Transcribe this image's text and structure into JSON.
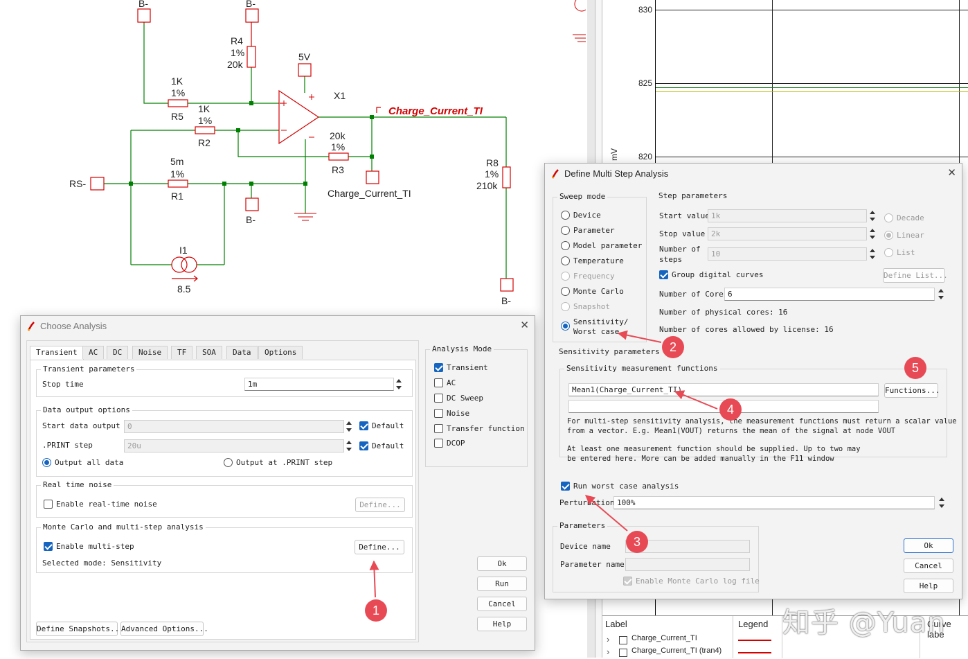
{
  "schematic": {
    "components": {
      "r4": {
        "name": "R4",
        "tol": "1%",
        "value": "20k"
      },
      "r5": {
        "name": "R5",
        "tol": "1%",
        "value": "1K"
      },
      "r2": {
        "name": "R2",
        "tol": "1%",
        "value": "1K"
      },
      "r1": {
        "name": "R1",
        "tol": "1%",
        "value": "5m"
      },
      "r3": {
        "name": "R3",
        "tol": "1%",
        "value": "20k"
      },
      "r8": {
        "name": "R8",
        "tol": "1%",
        "value": "210k"
      },
      "i1": {
        "name": "I1",
        "value": "8.5"
      },
      "x1": {
        "name": "X1"
      }
    },
    "nets": {
      "b_minus": "B-",
      "supply": "5V",
      "rs_minus": "RS-",
      "probe_label": "Charge_Current_TI",
      "node_label": "Charge_Current_TI"
    }
  },
  "graph": {
    "y_ticks": [
      "830",
      "825",
      "820"
    ],
    "y_unit_label": "mV",
    "legend_header_label": "Label",
    "legend_header_legend": "Legend",
    "legend_header_curve": "Curve labe",
    "traces": [
      {
        "label": "Charge_Current_TI",
        "color": "#d40000"
      },
      {
        "label": "Charge_Current_TI (tran4)",
        "color": "#d40000"
      }
    ]
  },
  "watermark": "知乎 @Yuan",
  "choose_analysis": {
    "title": "Choose Analysis",
    "tabs": [
      "Transient",
      "AC",
      "DC",
      "Noise",
      "TF",
      "SOA",
      "Data",
      "Options"
    ],
    "active_tab": "Transient",
    "transient_params": {
      "title": "Transient parameters",
      "stop_time_label": "Stop time",
      "stop_time_value": "1m"
    },
    "data_output": {
      "title": "Data output options",
      "start_label": "Start data output @",
      "start_value": "0",
      "start_default_label": "Default",
      "start_default_checked": true,
      "print_step_label": ".PRINT step",
      "print_step_value": "20u",
      "print_default_label": "Default",
      "print_default_checked": true,
      "output_all_label": "Output all data",
      "output_print_label": "Output at .PRINT step",
      "output_mode": "all"
    },
    "real_time_noise": {
      "title": "Real time noise",
      "enable_label": "Enable real-time noise",
      "enabled": false,
      "define_label": "Define..."
    },
    "monte_carlo": {
      "title": "Monte Carlo and multi-step analysis",
      "enable_label": "Enable multi-step",
      "enabled": true,
      "define_label": "Define...",
      "selected_mode": "Selected mode: Sensitivity"
    },
    "define_snapshots_label": "Define Snapshots...",
    "advanced_options_label": "Advanced Options...",
    "analysis_mode": {
      "title": "Analysis Mode",
      "items": [
        {
          "label": "Transient",
          "checked": true
        },
        {
          "label": "AC",
          "checked": false
        },
        {
          "label": "DC Sweep",
          "checked": false
        },
        {
          "label": "Noise",
          "checked": false
        },
        {
          "label": "Transfer function",
          "checked": false
        },
        {
          "label": "DCOP",
          "checked": false
        }
      ]
    },
    "buttons": {
      "ok": "Ok",
      "run": "Run",
      "cancel": "Cancel",
      "help": "Help"
    }
  },
  "multi_step": {
    "title": "Define Multi Step Analysis",
    "sweep_mode": {
      "title": "Sweep mode",
      "selected": "Sensitivity/ Worst case",
      "items": [
        {
          "label": "Device",
          "enabled": true
        },
        {
          "label": "Parameter",
          "enabled": true
        },
        {
          "label": "Model parameter",
          "enabled": true
        },
        {
          "label": "Temperature",
          "enabled": true
        },
        {
          "label": "Frequency",
          "enabled": false
        },
        {
          "label": "Monte Carlo",
          "enabled": true
        },
        {
          "label": "Snapshot",
          "enabled": false
        }
      ],
      "selected_line1": "Sensitivity/",
      "selected_line2": "Worst case"
    },
    "step_params": {
      "title": "Step parameters",
      "start_label": "Start value",
      "start_value": "1k",
      "stop_label": "Stop value",
      "stop_value": "2k",
      "nsteps_label_1": "Number of",
      "nsteps_label_2": "steps",
      "nsteps_value": "10",
      "decade_label": "Decade",
      "linear_label": "Linear",
      "list_label": "List",
      "scale": "Linear",
      "group_digital_label": "Group digital curves",
      "group_digital_checked": true,
      "define_list_label": "Define List...",
      "cores_label": "Number of Cores",
      "cores_value": "6",
      "physical_cores_text": "Number of physical cores: 16",
      "license_cores_text": "Number of cores allowed by license: 16"
    },
    "sensitivity": {
      "title": "Sensitivity parameters",
      "functions_title": "Sensitivity measurement functions",
      "function_1": "Mean1(Charge_Current_TI)",
      "function_2": "",
      "functions_button": "Functions...",
      "help_para_1_line_1": "For multi-step sensitivity analysis, the measurement functions must return a scalar value",
      "help_para_1_line_2": "from a vector. E.g. Mean1(VOUT) returns the mean of the signal at node VOUT",
      "help_para_2_line_1": "At least one measurement function should be supplied. Up to two may",
      "help_para_2_line_2": "be entered here. More can be added manually in the F11 window",
      "worst_case_label": "Run worst case analysis",
      "worst_case_checked": true,
      "perturbation_label": "Perturbation",
      "perturbation_value": "100%"
    },
    "parameters": {
      "title": "Parameters",
      "device_name_label": "Device name",
      "device_name_value": "",
      "param_name_label": "Parameter name",
      "param_name_value": "",
      "enable_mc_log_label": "Enable Monte Carlo log file",
      "enable_mc_log_checked": true
    },
    "buttons": {
      "ok": "Ok",
      "cancel": "Cancel",
      "help": "Help"
    }
  },
  "markers": [
    "1",
    "2",
    "3",
    "4",
    "5"
  ],
  "colors": {
    "wire": "#008000",
    "net_label": "#d40000",
    "component": "#d40000",
    "marker": "#e84a55",
    "accent": "#1565c0"
  }
}
